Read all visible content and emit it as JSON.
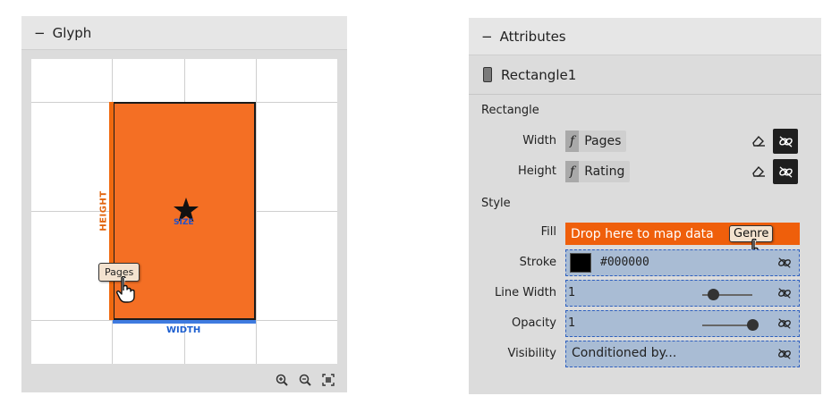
{
  "glyph_panel": {
    "collapse_symbol": "−",
    "title": "Glyph",
    "height_label": "HEIGHT",
    "width_label": "WIDTH",
    "size_label": "SIZE",
    "pages_chip": "Pages",
    "rect_color": "#f46f24",
    "height_color": "#f0690f",
    "width_color": "#3f7be0",
    "zoom_icons": [
      "zoom-in-icon",
      "zoom-out-icon",
      "zoom-fit-icon"
    ]
  },
  "attributes_panel": {
    "collapse_symbol": "−",
    "title": "Attributes",
    "object_name": "Rectangle1",
    "rectangle_section": "Rectangle",
    "style_section": "Style",
    "rows": {
      "width": {
        "label": "Width",
        "fx": "f",
        "value": "Pages"
      },
      "height": {
        "label": "Height",
        "fx": "f",
        "value": "Rating"
      },
      "fill": {
        "label": "Fill",
        "placeholder": "Drop here to map data",
        "drag_chip": "Genre",
        "color": "#ef5f0b"
      },
      "stroke": {
        "label": "Stroke",
        "value": "#000000"
      },
      "line_width": {
        "label": "Line Width",
        "value": "1",
        "slider_level": 0.22
      },
      "opacity": {
        "label": "Opacity",
        "value": "1",
        "slider_level": 1.0
      },
      "visibility": {
        "label": "Visibility",
        "value": "Conditioned by..."
      }
    }
  }
}
